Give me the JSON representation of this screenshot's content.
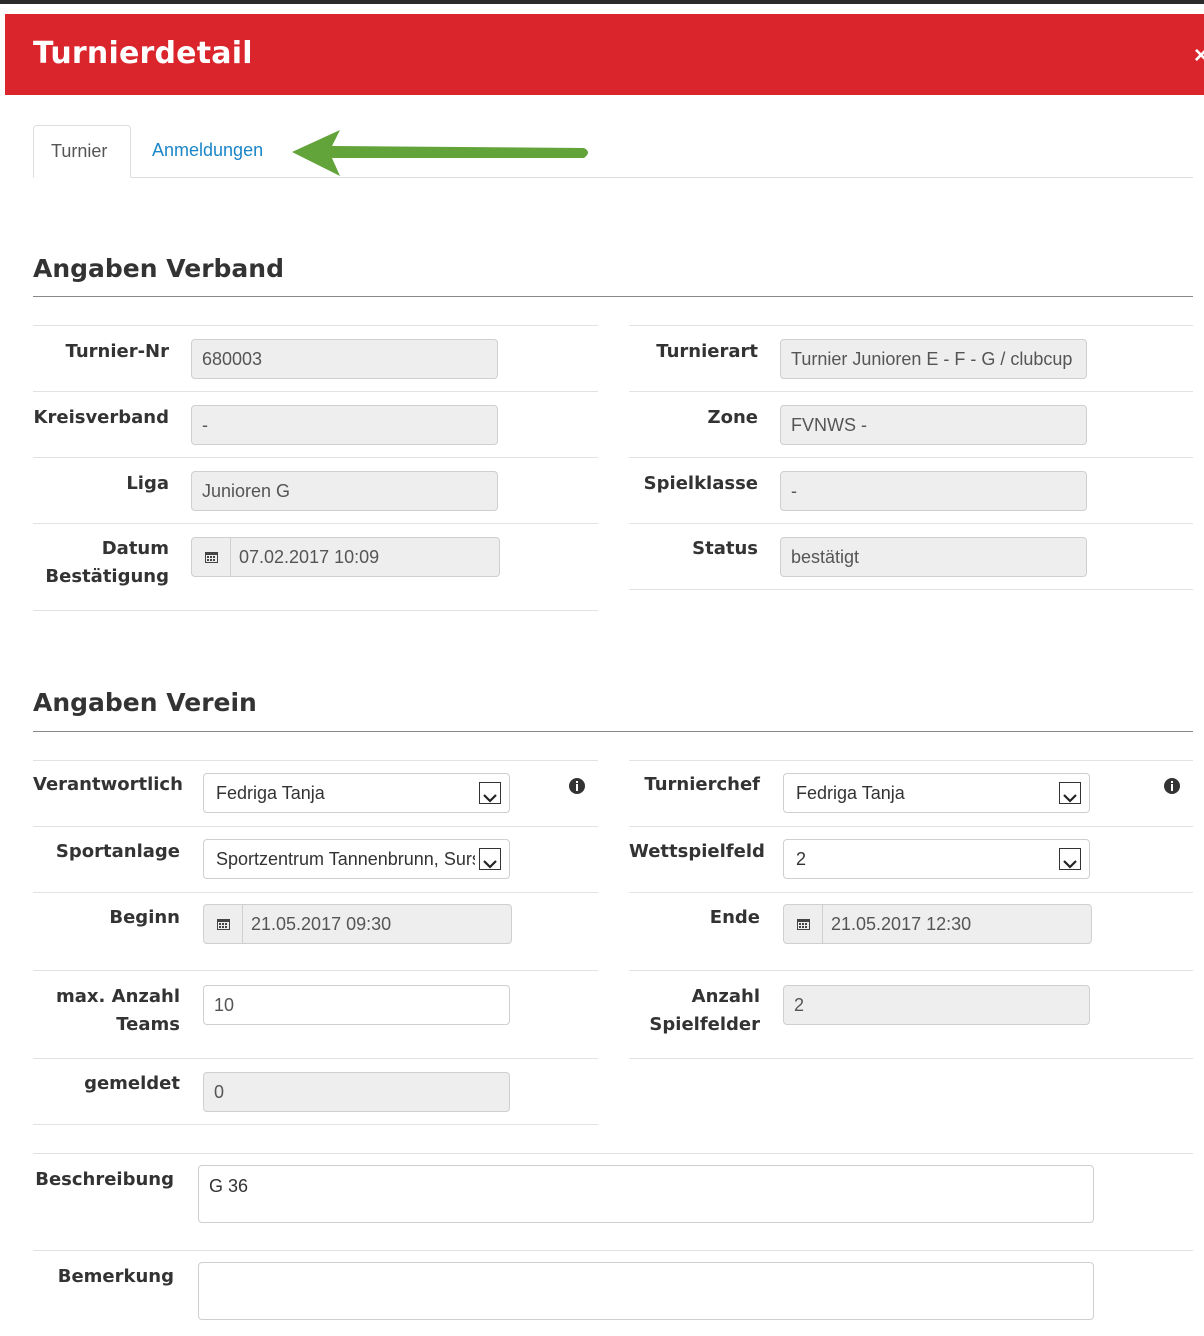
{
  "header": {
    "title": "Turnierdetail",
    "close": "×",
    "color": "#d9252b"
  },
  "tabs": [
    {
      "label": "Turnier",
      "active": true
    },
    {
      "label": "Anmeldungen",
      "active": false
    }
  ],
  "annotation": {
    "arrow_color": "#5a9e2f"
  },
  "verband": {
    "title": "Angaben Verband",
    "turnier_nr": {
      "label": "Turnier-Nr",
      "value": "680003"
    },
    "kreisverband": {
      "label": "Kreisverband",
      "value": "-"
    },
    "liga": {
      "label": "Liga",
      "value": "Junioren G"
    },
    "datum": {
      "label1": "Datum",
      "label2": "Bestätigung",
      "value": "07.02.2017 10:09"
    },
    "turnierart": {
      "label": "Turnierart",
      "value": "Turnier Junioren E - F - G / clubcup"
    },
    "zone": {
      "label": "Zone",
      "value": "FVNWS -"
    },
    "spielklasse": {
      "label": "Spielklasse",
      "value": "-"
    },
    "status": {
      "label": "Status",
      "value": "bestätigt"
    }
  },
  "verein": {
    "title": "Angaben Verein",
    "verantwortlich": {
      "label": "Verantwortlich",
      "value": "Fedriga Tanja"
    },
    "sportanlage": {
      "label": "Sportanlage",
      "value": "Sportzentrum Tannenbrunn, Sursee"
    },
    "beginn": {
      "label": "Beginn",
      "value": "21.05.2017 09:30"
    },
    "max_teams": {
      "label1": "max. Anzahl",
      "label2": "Teams",
      "value": "10"
    },
    "gemeldet": {
      "label": "gemeldet",
      "value": "0"
    },
    "turnierchef": {
      "label": "Turnierchef",
      "value": "Fedriga Tanja"
    },
    "wettspielfeld": {
      "label": "Wettspielfeld",
      "value": "2"
    },
    "ende": {
      "label": "Ende",
      "value": "21.05.2017 12:30"
    },
    "spielfelder": {
      "label1": "Anzahl",
      "label2": "Spielfelder",
      "value": "2"
    },
    "beschreibung": {
      "label": "Beschreibung",
      "value": "G 36"
    },
    "bemerkung": {
      "label": "Bemerkung",
      "value": ""
    }
  }
}
